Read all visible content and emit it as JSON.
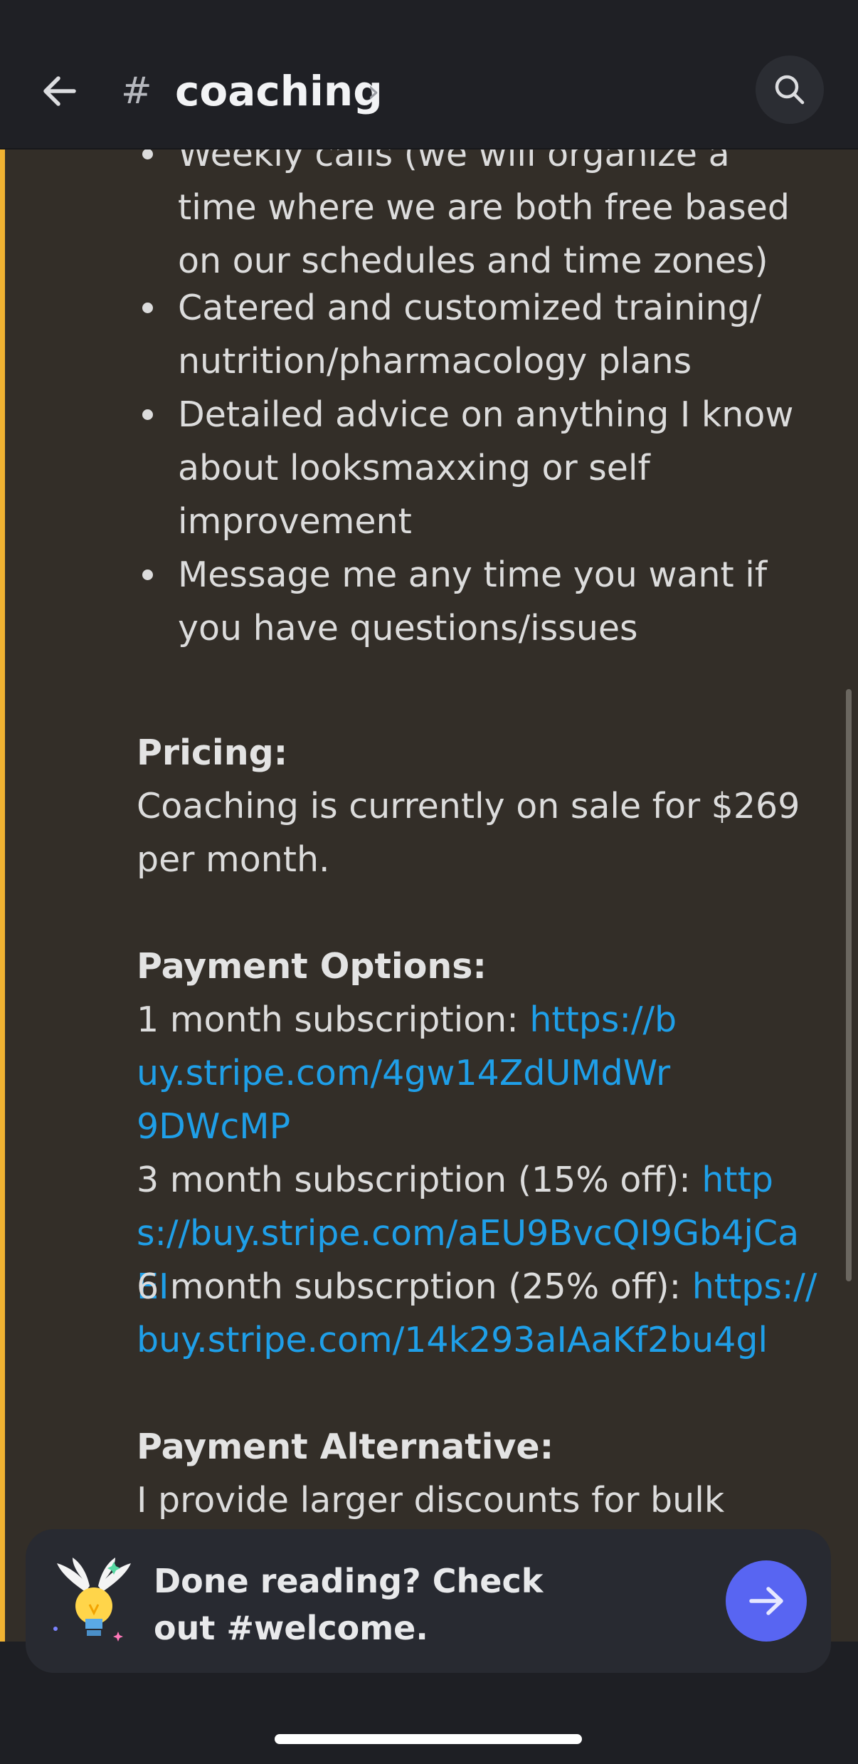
{
  "header": {
    "hash_symbol": "#",
    "channel_name": "coaching",
    "chevron": "›",
    "back_icon": "arrow-left-icon",
    "search_icon": "search-icon"
  },
  "message": {
    "bullets": [
      "Weekly calls (we will organize a time where we are both free based on our schedules and time zones)",
      "Catered and customized training/ nutrition/pharmacology plans",
      "Detailed advice on anything I know about looksmaxxing or self improvement",
      "Message me any time you want if you have questions/issues"
    ],
    "pricing": {
      "heading": "Pricing:",
      "text": "Coaching is currently on sale for $269 per month."
    },
    "payment": {
      "heading": "Payment Options:",
      "options": [
        {
          "label": "1 month subscription: ",
          "url": "https://buy.stripe.com/4gw14ZdUMdWr9DWcMP"
        },
        {
          "label": "3 month subscription (15% off): ",
          "url": "https://buy.stripe.com/aEU9BvcQI9Gb4jCaEI"
        },
        {
          "label": "6 month subscrption (25% off): ",
          "url": "https://buy.stripe.com/14k293aIAaKf2bu4gl"
        }
      ]
    },
    "alternative": {
      "heading": "Payment Alternative:",
      "text": "I provide larger discounts for bulk"
    }
  },
  "cta": {
    "text": "Done reading? Check out #welcome.",
    "icon": "winged-lightbulb-icon",
    "button_icon": "arrow-right-icon"
  },
  "colors": {
    "accent": "#f0b232",
    "link": "#1f9fe8",
    "button": "#5865f2"
  }
}
